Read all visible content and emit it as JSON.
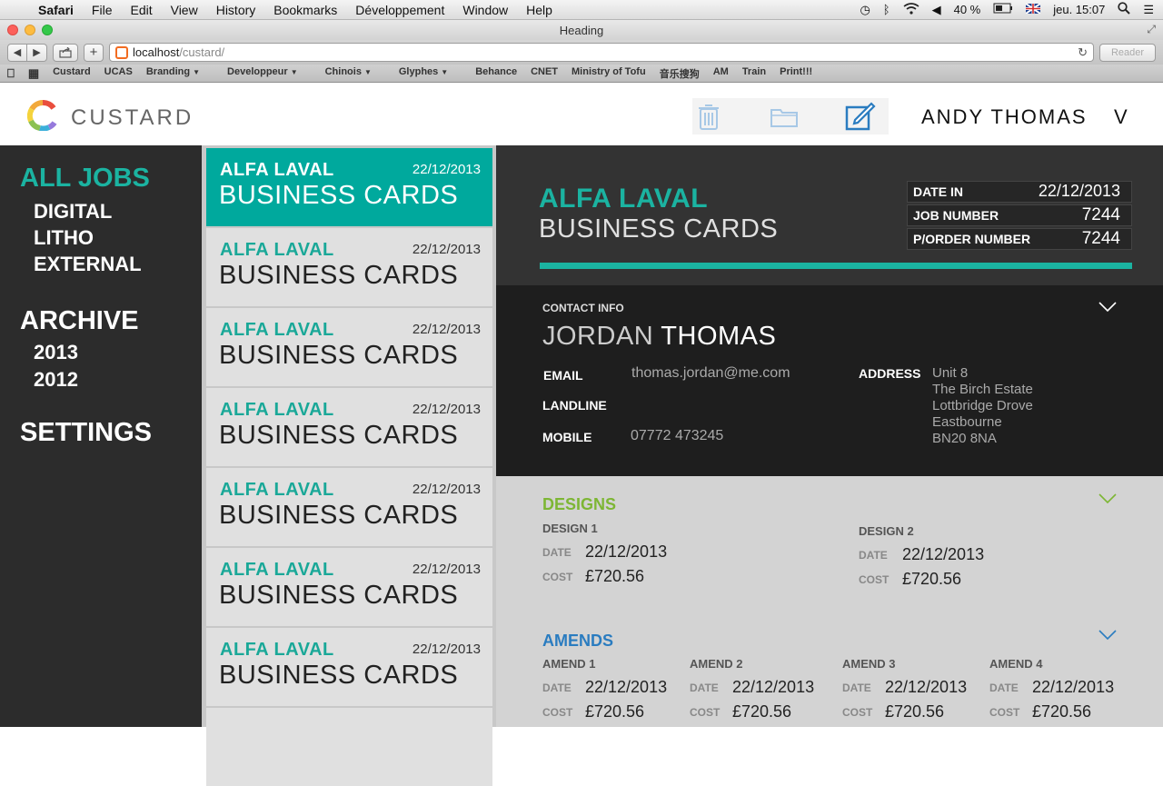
{
  "menubar": {
    "app": "Safari",
    "items": [
      "File",
      "Edit",
      "View",
      "History",
      "Bookmarks",
      "Développement",
      "Window",
      "Help"
    ],
    "battery": "40 %",
    "clock": "jeu. 15:07"
  },
  "browser": {
    "title": "Heading",
    "url_host": "localhost",
    "url_path": "/custard/",
    "reader": "Reader",
    "bookmarks": [
      {
        "label": "Custard",
        "menu": false
      },
      {
        "label": "UCAS",
        "menu": false
      },
      {
        "label": "Branding",
        "menu": true
      },
      {
        "label": "Developpeur",
        "menu": true
      },
      {
        "label": "Chinois",
        "menu": true
      },
      {
        "label": "Glyphes",
        "menu": true
      },
      {
        "label": "Behance",
        "menu": false
      },
      {
        "label": "CNET",
        "menu": false
      },
      {
        "label": "Ministry of Tofu",
        "menu": false
      },
      {
        "label": "音乐搜狗",
        "menu": false
      },
      {
        "label": "AM",
        "menu": false
      },
      {
        "label": "Train",
        "menu": false
      },
      {
        "label": "Print!!!",
        "menu": false
      }
    ]
  },
  "header": {
    "brand": "CUSTARD",
    "user": "ANDY THOMAS",
    "user_menu": "V",
    "icons": [
      "trash-icon",
      "folder-icon",
      "edit-icon"
    ],
    "accent": "#1bb3a1"
  },
  "sidebar": {
    "all_jobs": "ALL JOBS",
    "categories": [
      "DIGITAL",
      "LITHO",
      "EXTERNAL"
    ],
    "archive": "ARCHIVE",
    "years": [
      "2013",
      "2012"
    ],
    "settings": "SETTINGS"
  },
  "jobs": [
    {
      "client": "ALFA LAVAL",
      "product": "BUSINESS CARDS",
      "date": "22/12/2013",
      "active": true
    },
    {
      "client": "ALFA LAVAL",
      "product": "BUSINESS CARDS",
      "date": "22/12/2013"
    },
    {
      "client": "ALFA LAVAL",
      "product": "BUSINESS CARDS",
      "date": "22/12/2013"
    },
    {
      "client": "ALFA LAVAL",
      "product": "BUSINESS CARDS",
      "date": "22/12/2013"
    },
    {
      "client": "ALFA LAVAL",
      "product": "BUSINESS CARDS",
      "date": "22/12/2013"
    },
    {
      "client": "ALFA LAVAL",
      "product": "BUSINESS CARDS",
      "date": "22/12/2013"
    },
    {
      "client": "ALFA LAVAL",
      "product": "BUSINESS CARDS",
      "date": "22/12/2013"
    }
  ],
  "detail": {
    "client": "ALFA LAVAL",
    "product": "BUSINESS CARDS",
    "meta": [
      {
        "label": "DATE IN",
        "value": "22/12/2013"
      },
      {
        "label": "JOB NUMBER",
        "value": "7244"
      },
      {
        "label": "P/ORDER NUMBER",
        "value": "7244"
      }
    ],
    "contact": {
      "title": "CONTACT INFO",
      "first_name": "JORDAN",
      "last_name": "THOMAS",
      "email_label": "EMAIL",
      "email": "thomas.jordan@me.com",
      "landline_label": "LANDLINE",
      "mobile_label": "MOBILE",
      "mobile": "07772 473245",
      "address_label": "ADDRESS",
      "address": [
        "Unit 8",
        "The Birch Estate",
        "Lottbridge Drove",
        "Eastbourne",
        "BN20 8NA"
      ]
    },
    "designs": {
      "title": "DESIGNS",
      "color": "#7db634",
      "items": [
        {
          "name": "DESIGN 1",
          "date": "22/12/2013",
          "cost": "£720.56"
        },
        {
          "name": "DESIGN 2",
          "date": "22/12/2013",
          "cost": "£720.56"
        }
      ]
    },
    "amends": {
      "title": "AMENDS",
      "color": "#2a7cc0",
      "items": [
        {
          "name": "AMEND 1",
          "date": "22/12/2013",
          "cost": "£720.56"
        },
        {
          "name": "AMEND 2",
          "date": "22/12/2013",
          "cost": "£720.56"
        },
        {
          "name": "AMEND 3",
          "date": "22/12/2013",
          "cost": "£720.56"
        },
        {
          "name": "AMEND 4",
          "date": "22/12/2013",
          "cost": "£720.56"
        }
      ]
    },
    "date_label": "DATE",
    "cost_label": "COST"
  }
}
